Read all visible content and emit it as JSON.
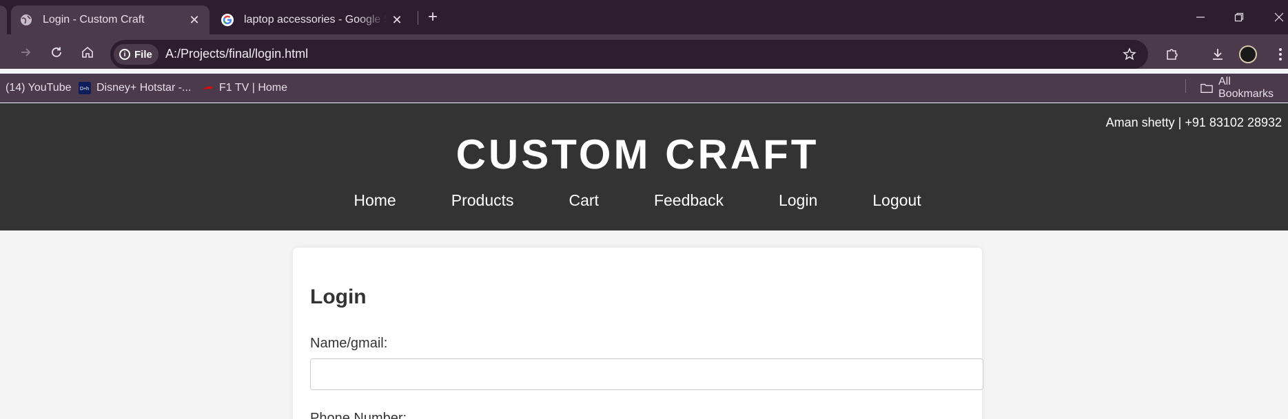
{
  "browser": {
    "tabs": [
      {
        "title": "Login - Custom Craft",
        "active": true
      },
      {
        "title": "laptop accessories - Google Search",
        "active": false
      }
    ],
    "chip_label": "File",
    "url": "A:/Projects/final/login.html",
    "bookmarks": [
      {
        "label": "(14) YouTube"
      },
      {
        "label": "Disney+ Hotstar -..."
      },
      {
        "label": "F1 TV | Home"
      }
    ],
    "all_bookmarks_label": "All Bookmarks"
  },
  "site": {
    "contact": "Aman shetty | +91 83102 28932",
    "brand": "CUSTOM CRAFT",
    "nav": [
      "Home",
      "Products",
      "Cart",
      "Feedback",
      "Login",
      "Logout"
    ]
  },
  "login": {
    "heading": "Login",
    "name_label": "Name/gmail:",
    "name_value": "",
    "phone_label": "Phone Number:"
  },
  "colors": {
    "header_bg": "#333333",
    "chrome_dark": "#2c1e2e",
    "chrome_mid": "#4a3a4c",
    "page_bg": "#f4f4f4"
  }
}
